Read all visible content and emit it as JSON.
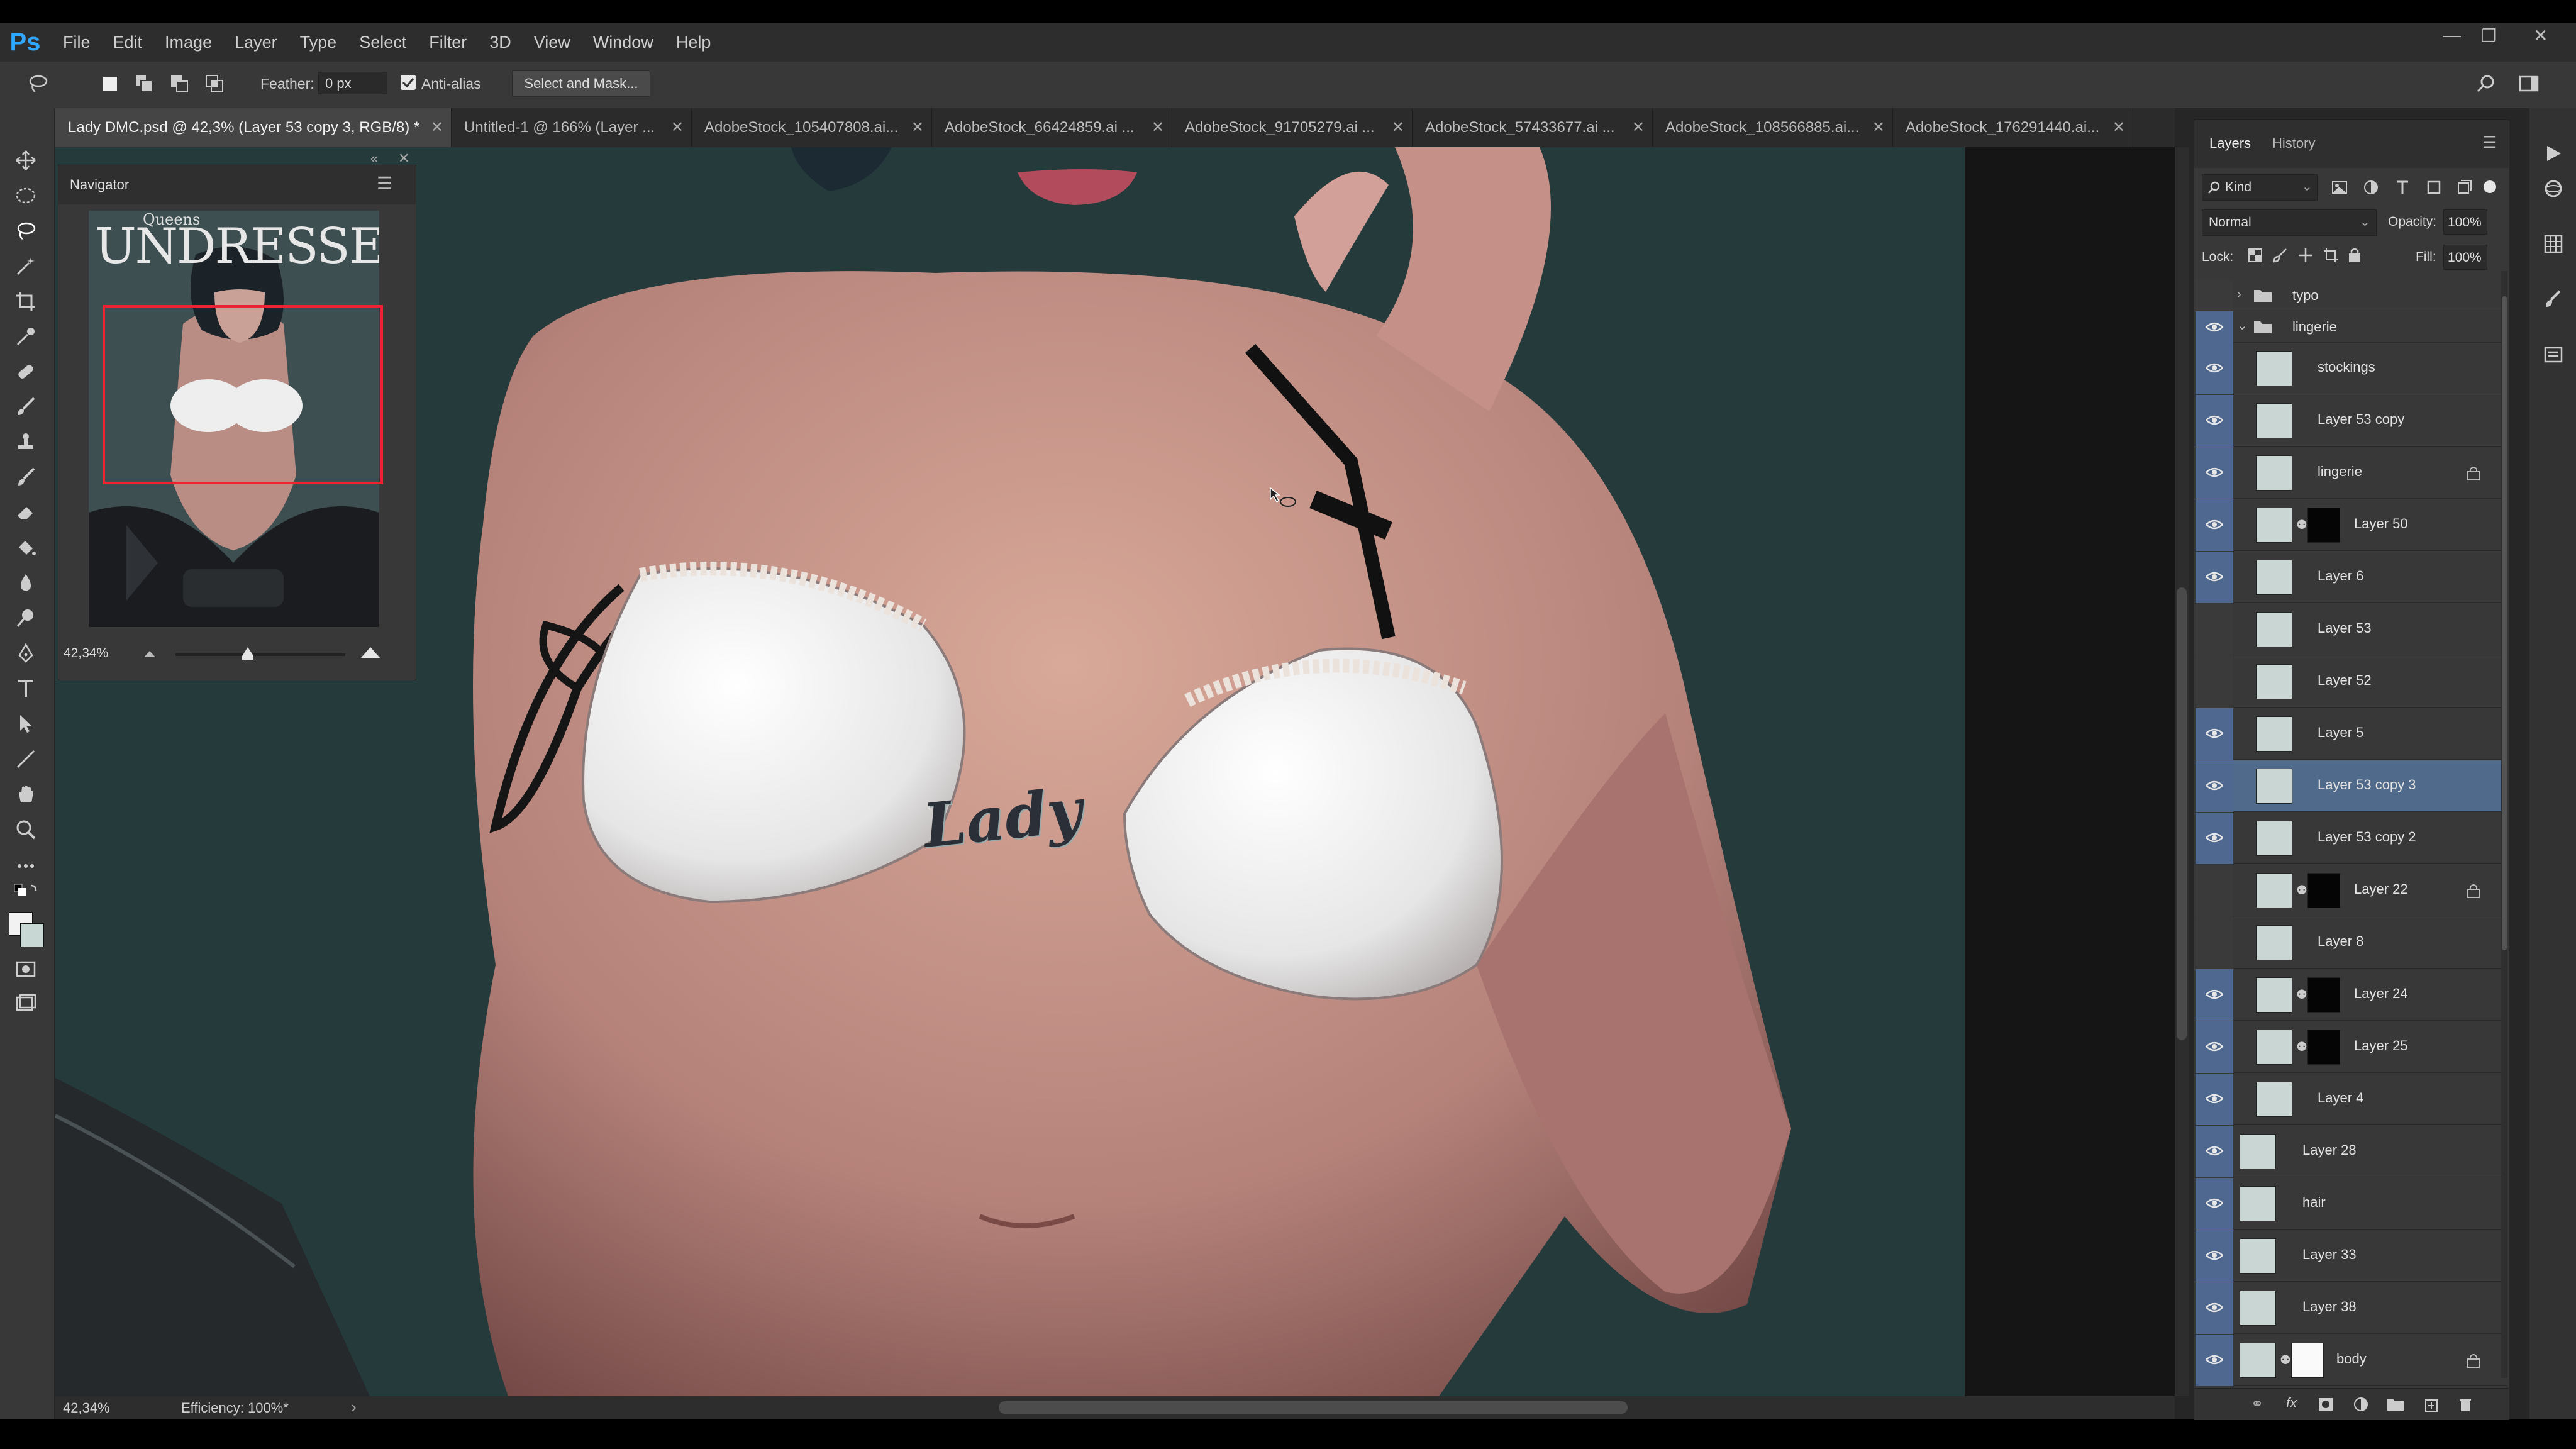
{
  "app": {
    "logo": "Ps",
    "accent": "#31a8ff"
  },
  "menu": [
    "File",
    "Edit",
    "Image",
    "Layer",
    "Type",
    "Select",
    "Filter",
    "3D",
    "View",
    "Window",
    "Help"
  ],
  "options": {
    "feather_label": "Feather:",
    "feather_value": "0 px",
    "antialias_label": "Anti-alias",
    "antialias_checked": true,
    "select_mask_label": "Select and Mask..."
  },
  "tabs": [
    {
      "label": "Lady DMC.psd @ 42,3% (Layer 53 copy 3, RGB/8) *",
      "active": true
    },
    {
      "label": "Untitled-1 @ 166% (Layer ...",
      "active": false
    },
    {
      "label": "AdobeStock_105407808.ai...",
      "active": false
    },
    {
      "label": "AdobeStock_66424859.ai ...",
      "active": false
    },
    {
      "label": "AdobeStock_91705279.ai ...",
      "active": false
    },
    {
      "label": "AdobeStock_57433677.ai ...",
      "active": false
    },
    {
      "label": "AdobeStock_108566885.ai...",
      "active": false
    },
    {
      "label": "AdobeStock_176291440.ai...",
      "active": false
    }
  ],
  "navigator": {
    "title": "Navigator",
    "zoom": "42,34%",
    "thumb_line1": "Queens",
    "thumb_line2": "UNDRESSED"
  },
  "canvas_text": "Lady",
  "status": {
    "zoom": "42,34%",
    "efficiency": "Efficiency: 100%*"
  },
  "layers_panel": {
    "tabs": [
      "Layers",
      "History"
    ],
    "filter_label": "Kind",
    "blend_mode": "Normal",
    "opacity_label": "Opacity:",
    "opacity_value": "100%",
    "lock_label": "Lock:",
    "fill_label": "Fill:",
    "fill_value": "100%",
    "groups": [
      {
        "name": "typo",
        "visible": false,
        "expanded": false
      },
      {
        "name": "lingerie",
        "visible": true,
        "expanded": true
      }
    ],
    "layers": [
      {
        "name": "stockings",
        "visible": true,
        "mask": false,
        "locked": false,
        "selected": false
      },
      {
        "name": "Layer 53 copy",
        "visible": true,
        "mask": false,
        "locked": false,
        "selected": false
      },
      {
        "name": "lingerie",
        "visible": true,
        "mask": false,
        "locked": true,
        "selected": false
      },
      {
        "name": "Layer 50",
        "visible": true,
        "mask": true,
        "locked": false,
        "selected": false
      },
      {
        "name": "Layer 6",
        "visible": true,
        "mask": false,
        "locked": false,
        "selected": false
      },
      {
        "name": "Layer 53",
        "visible": false,
        "mask": false,
        "locked": false,
        "selected": false
      },
      {
        "name": "Layer 52",
        "visible": false,
        "mask": false,
        "locked": false,
        "selected": false
      },
      {
        "name": "Layer 5",
        "visible": true,
        "mask": false,
        "locked": false,
        "selected": false
      },
      {
        "name": "Layer 53 copy 3",
        "visible": true,
        "mask": false,
        "locked": false,
        "selected": true
      },
      {
        "name": "Layer 53 copy 2",
        "visible": true,
        "mask": false,
        "locked": false,
        "selected": false
      },
      {
        "name": "Layer 22",
        "visible": false,
        "mask": true,
        "locked": true,
        "selected": false
      },
      {
        "name": "Layer 8",
        "visible": false,
        "mask": false,
        "locked": false,
        "selected": false
      },
      {
        "name": "Layer 24",
        "visible": true,
        "mask": true,
        "locked": false,
        "selected": false
      },
      {
        "name": "Layer 25",
        "visible": true,
        "mask": true,
        "locked": false,
        "selected": false
      },
      {
        "name": "Layer 4",
        "visible": true,
        "mask": false,
        "locked": false,
        "selected": false
      },
      {
        "name": "Layer 28",
        "visible": true,
        "mask": false,
        "locked": false,
        "selected": false
      },
      {
        "name": "hair",
        "visible": true,
        "mask": false,
        "locked": false,
        "selected": false
      },
      {
        "name": "Layer 33",
        "visible": true,
        "mask": false,
        "locked": false,
        "selected": false
      },
      {
        "name": "Layer 38",
        "visible": true,
        "mask": false,
        "locked": false,
        "selected": false
      },
      {
        "name": "body",
        "visible": true,
        "mask": true,
        "locked": true,
        "selected": false
      }
    ]
  },
  "tools": [
    "move-icon",
    "marquee-icon",
    "lasso-icon",
    "magic-wand-icon",
    "crop-icon",
    "eyedropper-icon",
    "healing-brush-icon",
    "brush-icon",
    "clone-stamp-icon",
    "history-brush-icon",
    "eraser-icon",
    "paint-bucket-icon",
    "blur-icon",
    "dodge-icon",
    "pen-icon",
    "type-icon",
    "path-select-icon",
    "line-icon",
    "hand-icon",
    "zoom-icon",
    "more-tools-icon"
  ]
}
